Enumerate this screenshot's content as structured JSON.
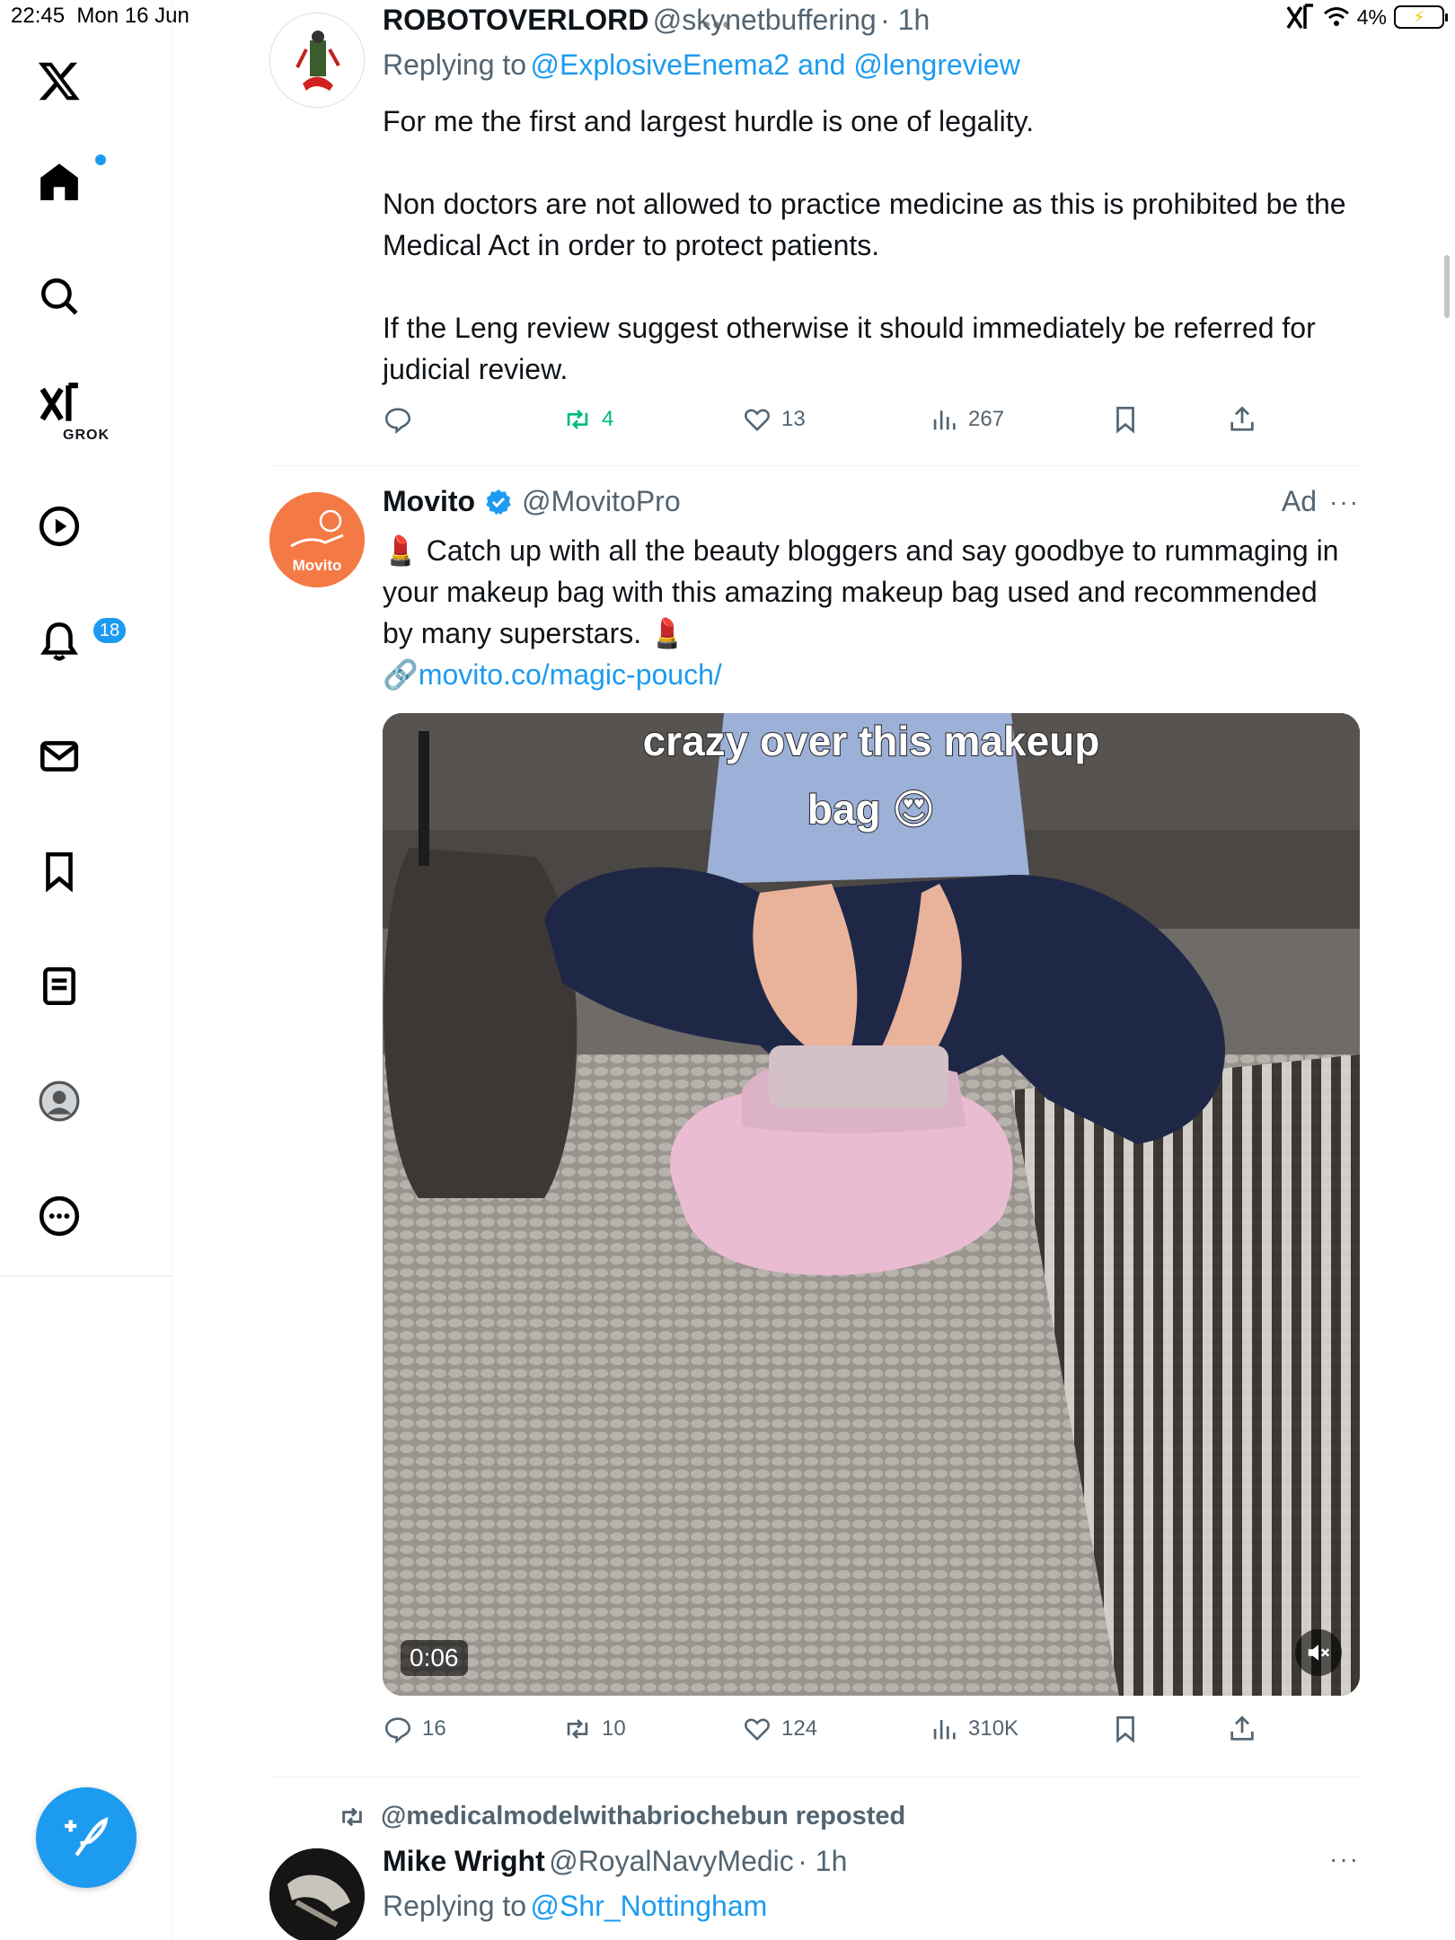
{
  "status_bar": {
    "time": "22:45",
    "date": "Mon 16 Jun",
    "battery": "4%"
  },
  "sidebar": {
    "grok_label": "GROK",
    "notifications_badge": "18"
  },
  "tweets": [
    {
      "name": "ROBOTOVERLORD",
      "handle": "@skynetbuffering",
      "time": "· 1h",
      "replying_prefix": "Replying to",
      "replying_to": "@ExplosiveEnema2 and @lengreview",
      "paragraphs": [
        "For me the first and largest hurdle is one of legality.",
        "Non doctors are not allowed to practice medicine as this is prohibited be the Medical Act in order to protect patients.",
        "If the Leng review suggest otherwise it should immediately be referred for judicial review."
      ],
      "replies": "",
      "reposts": "4",
      "likes": "13",
      "views": "267"
    },
    {
      "name": "Movito",
      "handle": "@MovitoPro",
      "ad_label": "Ad",
      "avatar_label": "Movito",
      "text_emoji": "💄",
      "text": "Catch up with all the beauty bloggers and say goodbye to rummaging in your makeup bag with this amazing makeup bag used and recommended by many superstars.",
      "link_icon": "🔗",
      "link": "movito.co/magic-pouch/",
      "video_caption_line1": "crazy over this makeup",
      "video_caption_line2": "bag 😍",
      "duration": "0:06",
      "replies": "16",
      "reposts": "10",
      "likes": "124",
      "views": "310K"
    },
    {
      "repost_by": "@medicalmodelwithabriochebun reposted",
      "name": "Mike Wright",
      "handle": "@RoyalNavyMedic",
      "time": "· 1h",
      "replying_prefix": "Replying to",
      "replying_to": "@Shr_Nottingham"
    }
  ],
  "colors": {
    "accent": "#1d9bf0",
    "text": "#0f1419",
    "muted": "#536471",
    "repost_green": "#00ba7c",
    "movito_orange": "#f47a45"
  },
  "icons": [
    "x-logo-icon",
    "home-icon",
    "search-icon",
    "grok-icon",
    "video-icon",
    "bell-icon",
    "mail-icon",
    "bookmark-icon",
    "lists-icon",
    "profile-icon",
    "more-icon",
    "compose-icon",
    "reply-icon",
    "repost-icon",
    "like-icon",
    "views-icon",
    "share-icon",
    "mute-icon"
  ]
}
